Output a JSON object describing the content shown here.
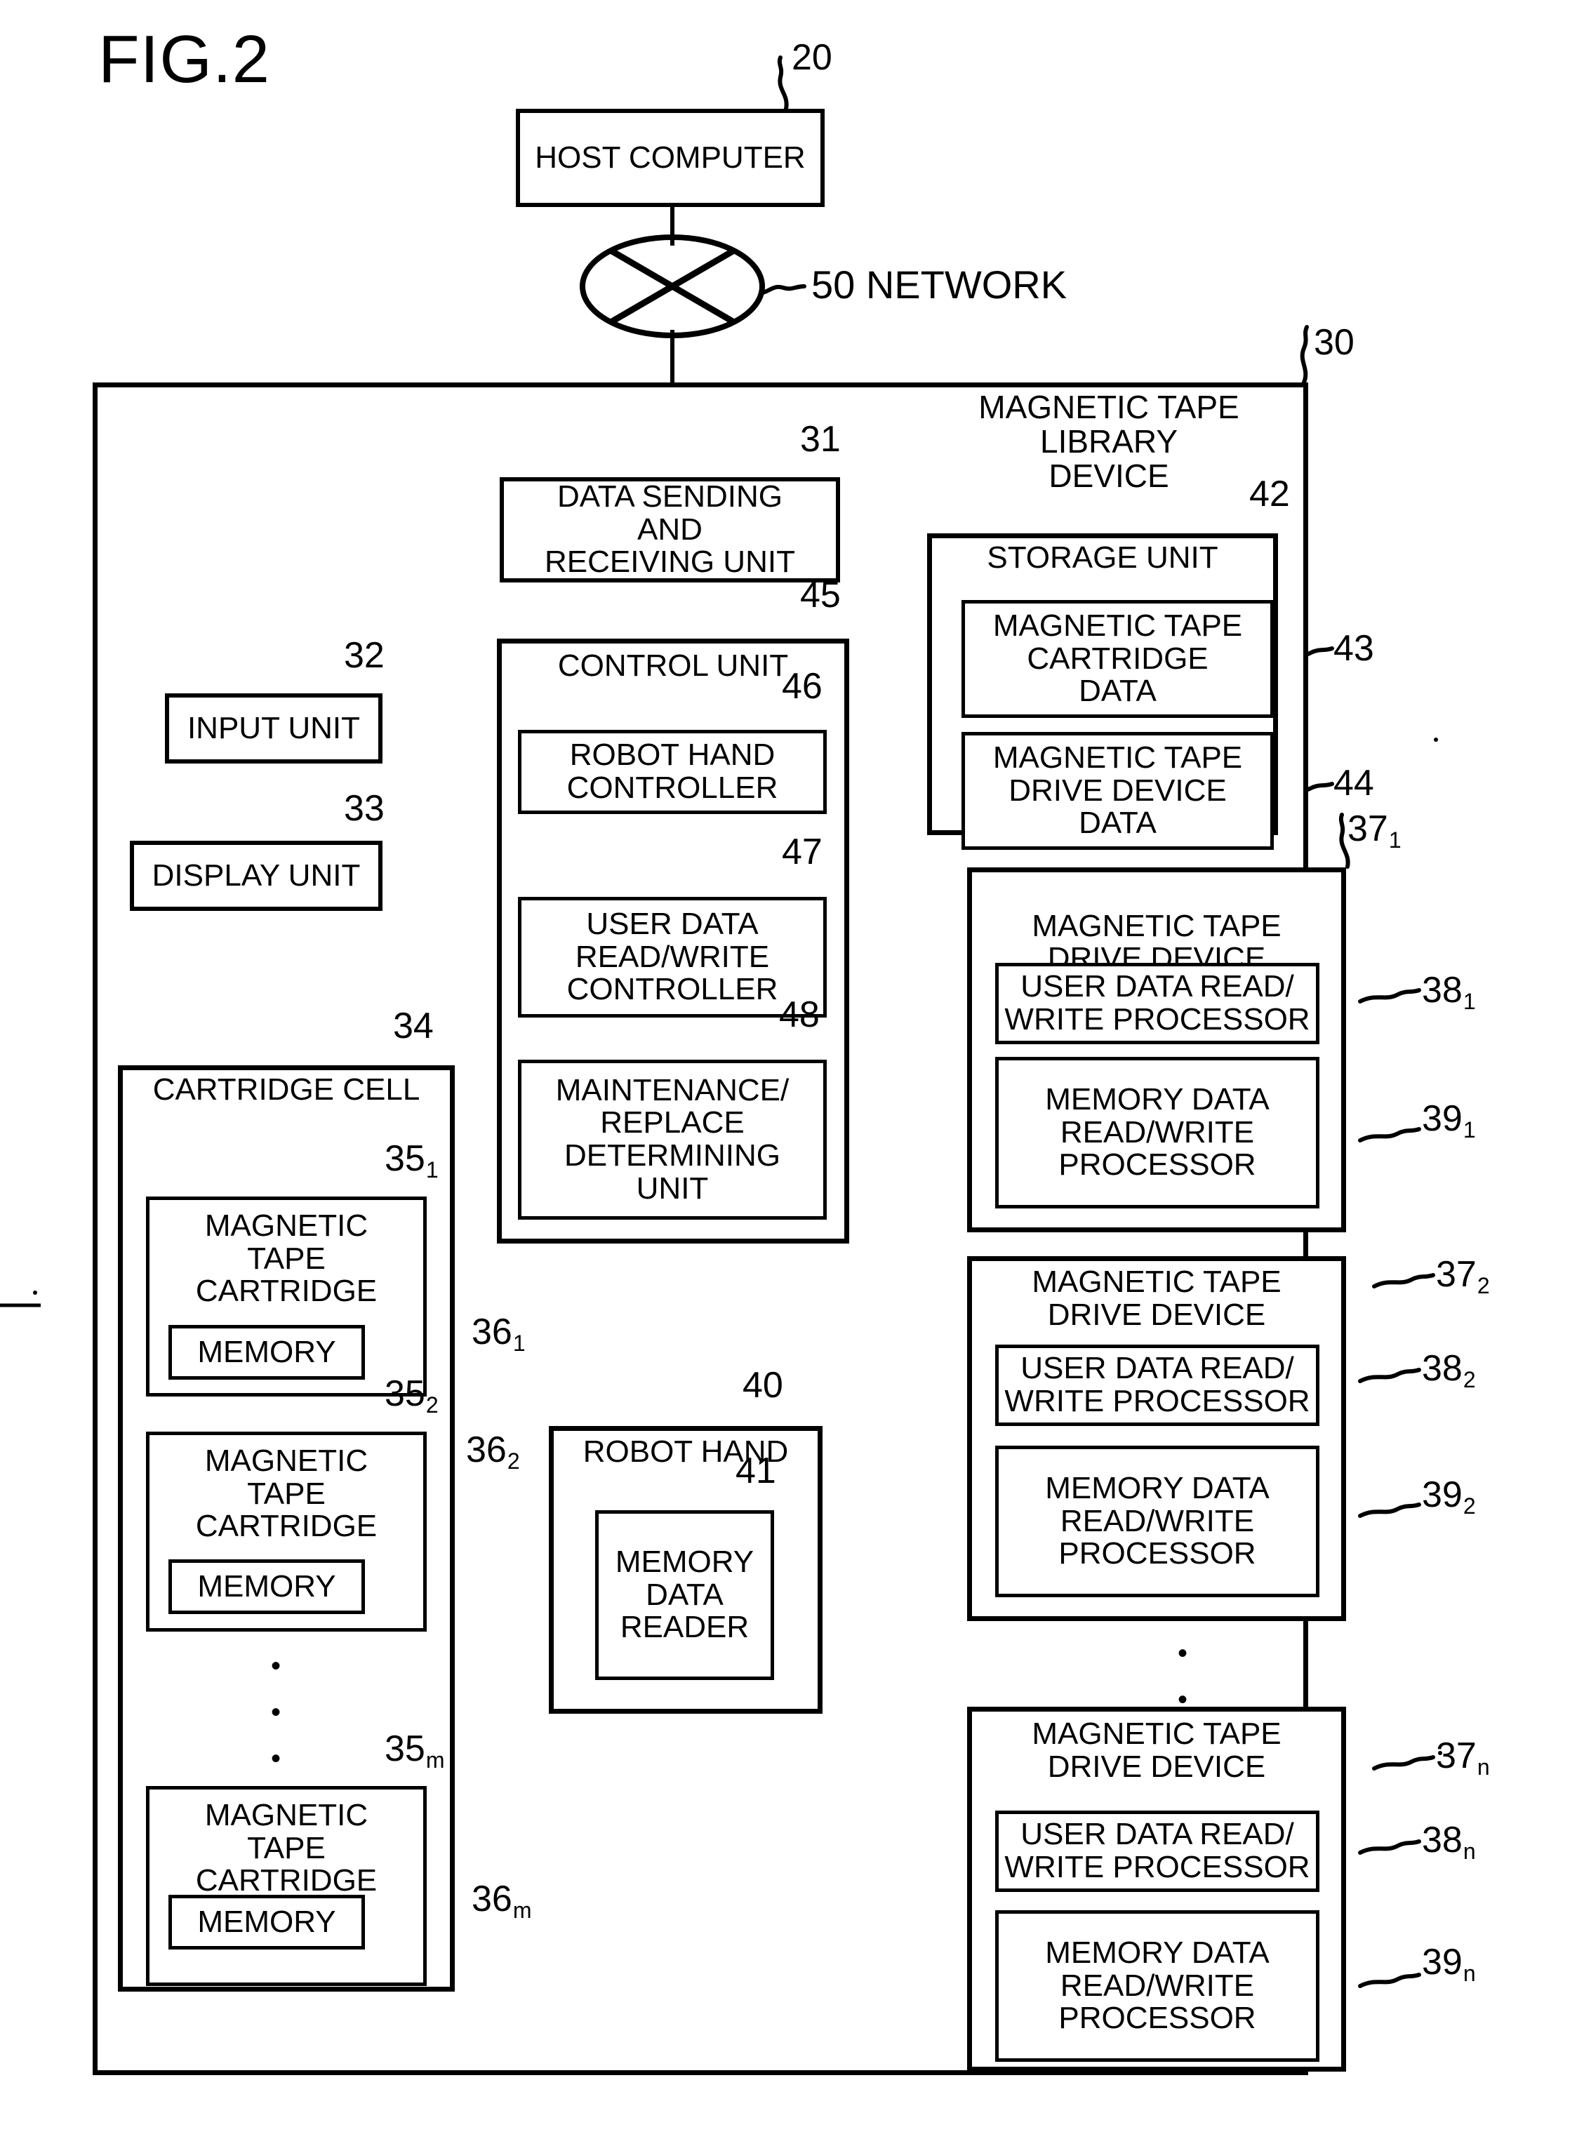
{
  "figure": {
    "title": "FIG.2"
  },
  "nodes": {
    "host_computer": {
      "label": "HOST\nCOMPUTER",
      "ref": "20"
    },
    "network": {
      "label": "NETWORK",
      "ref": "50"
    },
    "library_device": {
      "label": "MAGNETIC TAPE LIBRARY\nDEVICE",
      "ref": "30"
    },
    "data_send_recv": {
      "label": "DATA SENDING\nAND\nRECEIVING UNIT",
      "ref": "31"
    },
    "input_unit": {
      "label": "INPUT UNIT",
      "ref": "32"
    },
    "display_unit": {
      "label": "DISPLAY UNIT",
      "ref": "33"
    },
    "control_unit": {
      "label": "CONTROL UNIT",
      "ref": "45"
    },
    "robot_hand_controller": {
      "label": "ROBOT HAND\nCONTROLLER",
      "ref": "46"
    },
    "user_data_rw_controller": {
      "label": "USER DATA\nREAD/WRITE\nCONTROLLER",
      "ref": "47"
    },
    "maintenance_replace_unit": {
      "label": "MAINTENANCE/\nREPLACE\nDETERMINING\nUNIT",
      "ref": "48"
    },
    "storage_unit": {
      "label": "STORAGE UNIT",
      "ref": "42"
    },
    "cartridge_data": {
      "label": "MAGNETIC TAPE\nCARTRIDGE\nDATA",
      "ref": "43"
    },
    "drive_device_data": {
      "label": "MAGNETIC TAPE\nDRIVE DEVICE\nDATA",
      "ref": "44"
    },
    "cartridge_cell": {
      "label": "CARTRIDGE CELL",
      "ref": "34"
    },
    "robot_hand": {
      "label": "ROBOT HAND",
      "ref": "40"
    },
    "memory_data_reader": {
      "label": "MEMORY\nDATA\nREADER",
      "ref": "41"
    }
  },
  "cartridges": [
    {
      "label": "MAGNETIC\nTAPE\nCARTRIDGE",
      "ref": "35",
      "sub": "1",
      "memory": {
        "label": "MEMORY",
        "ref": "36",
        "sub": "1"
      }
    },
    {
      "label": "MAGNETIC\nTAPE\nCARTRIDGE",
      "ref": "35",
      "sub": "2",
      "memory": {
        "label": "MEMORY",
        "ref": "36",
        "sub": "2"
      }
    },
    {
      "label": "MAGNETIC\nTAPE\nCARTRIDGE",
      "ref": "35",
      "sub": "m",
      "memory": {
        "label": "MEMORY",
        "ref": "36",
        "sub": "m"
      }
    }
  ],
  "drives": [
    {
      "label": "MAGNETIC TAPE\nDRIVE DEVICE",
      "ref": "37",
      "sub": "1",
      "user_proc": {
        "label": "USER DATA READ/\nWRITE PROCESSOR",
        "ref": "38",
        "sub": "1"
      },
      "mem_proc": {
        "label": "MEMORY DATA\nREAD/WRITE\nPROCESSOR",
        "ref": "39",
        "sub": "1"
      }
    },
    {
      "label": "MAGNETIC TAPE\nDRIVE DEVICE",
      "ref": "37",
      "sub": "2",
      "user_proc": {
        "label": "USER DATA READ/\nWRITE PROCESSOR",
        "ref": "38",
        "sub": "2"
      },
      "mem_proc": {
        "label": "MEMORY DATA\nREAD/WRITE\nPROCESSOR",
        "ref": "39",
        "sub": "2"
      }
    },
    {
      "label": "MAGNETIC TAPE\nDRIVE DEVICE",
      "ref": "37",
      "sub": "n",
      "user_proc": {
        "label": "USER DATA READ/\nWRITE PROCESSOR",
        "ref": "38",
        "sub": "n"
      },
      "mem_proc": {
        "label": "MEMORY DATA\nREAD/WRITE\nPROCESSOR",
        "ref": "39",
        "sub": "n"
      }
    }
  ],
  "ellipsis": {
    "glyph": "•"
  },
  "colors": {
    "ink": "#000000",
    "paper": "#ffffff"
  }
}
